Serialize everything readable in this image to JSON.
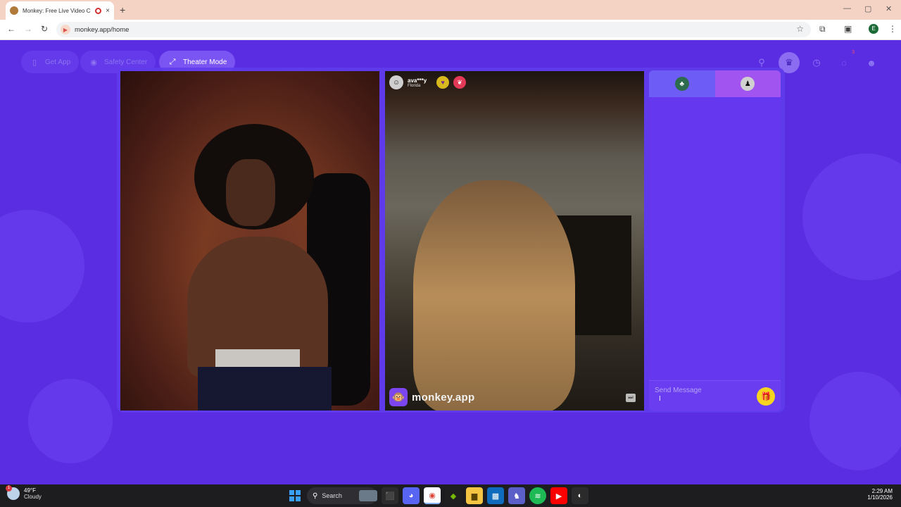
{
  "browser": {
    "tab_title": "Monkey: Free Live Video Ch",
    "tab_close": "×",
    "new_tab": "+",
    "url": "monkey.app/home",
    "window_controls": [
      "—",
      "▢",
      "✕"
    ]
  },
  "nav": {
    "get_app": "Get App",
    "safety_center": "Safety Center",
    "theater_mode": "Theater Mode",
    "notification_count": "3"
  },
  "call": {
    "partner_name": "ava***y",
    "partner_location": "Florida",
    "watermark": "monkey.app"
  },
  "chat": {
    "placeholder": "Send Message"
  },
  "taskbar": {
    "weather_temp": "49°F",
    "weather_condition": "Cloudy",
    "weather_badge": "1",
    "search_label": "Search",
    "time": "2:29 AM",
    "date": "1/10/2026"
  },
  "icons": {
    "phone": "phone-icon",
    "shield": "shield-icon",
    "expand": "expand-icon",
    "search": "search-icon",
    "crown": "crown-icon",
    "history": "clock-icon",
    "chat": "chat-icon",
    "profile": "avatar-icon",
    "gift": "gift-icon"
  },
  "colors": {
    "page_bg": "#5a2de3",
    "panel": "#6537ef",
    "accent_yellow": "#f6d31f"
  }
}
